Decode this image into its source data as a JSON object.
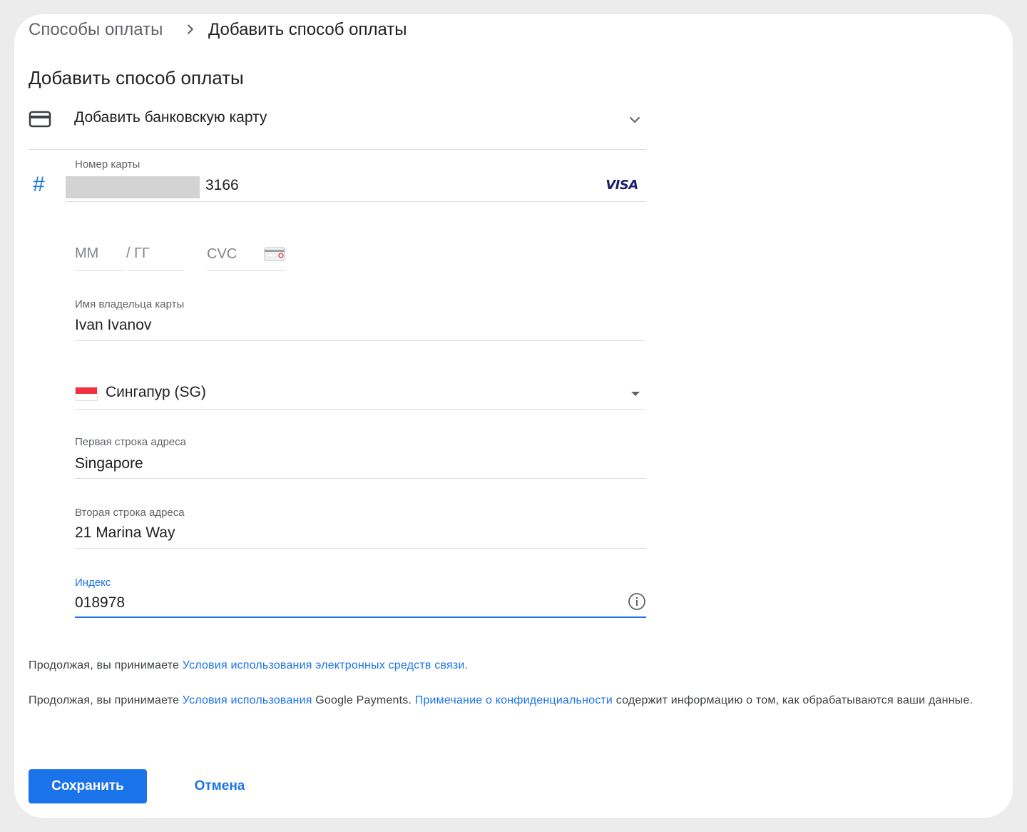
{
  "breadcrumb": {
    "parent": "Способы оплаты",
    "current": "Добавить способ оплаты"
  },
  "page_title": "Добавить способ оплаты",
  "method_selector": {
    "label": "Добавить банковскую карту",
    "icon": "credit-card-icon"
  },
  "card_number": {
    "label": "Номер карты",
    "last_digits": "3166",
    "brand": "VISA",
    "icon": "hash-icon"
  },
  "expiry": {
    "month_placeholder": "ММ",
    "year_placeholder": "/ ГГ"
  },
  "cvc": {
    "placeholder": "CVC",
    "icon": "cvc-card-icon"
  },
  "cardholder": {
    "label": "Имя владельца карты",
    "value": "Ivan Ivanov"
  },
  "country": {
    "value": "Сингапур (SG)",
    "flag": "singapore-flag-icon"
  },
  "address_line1": {
    "label": "Первая строка адреса",
    "value": "Singapore"
  },
  "address_line2": {
    "label": "Вторая строка адреса",
    "value": "21 Marina Way"
  },
  "postal_code": {
    "label": "Индекс",
    "value": "018978",
    "icon": "info-icon"
  },
  "legal": {
    "line1_prefix": "Продолжая, вы принимаете ",
    "line1_link": "Условия использования электронных средств связи",
    "line1_suffix": ".",
    "line2_prefix": "Продолжая, вы принимаете ",
    "line2_link1": "Условия использования",
    "line2_middle": " Google Payments. ",
    "line2_link2": "Примечание о конфиденциальности",
    "line2_suffix": " содержит информацию о том, как обрабатываются ваши данные."
  },
  "buttons": {
    "save": "Сохранить",
    "cancel": "Отмена"
  },
  "colors": {
    "accent": "#1a73e8",
    "text": "#202124",
    "muted": "#5f6368",
    "divider": "#dadce0"
  }
}
